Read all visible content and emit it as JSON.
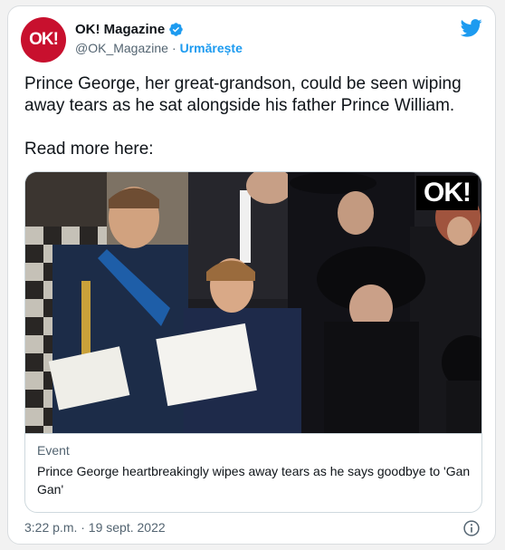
{
  "author": {
    "avatar_text": "OK!",
    "name": "OK! Magazine",
    "handle": "@OK_Magazine",
    "separator": "·",
    "follow_label": "Urmărește"
  },
  "tweet": {
    "line1": "Prince George, her great-grandson, could be seen wiping away tears as he sat alongside his father Prince William.",
    "line2": "Read more here:"
  },
  "link_card": {
    "image_logo": "OK!",
    "domain": "Event",
    "title": "Prince George heartbreakingly wipes away tears as he says goodbye to 'Gan Gan'"
  },
  "footer": {
    "timestamp": "3:22 p.m. · 19 sept. 2022"
  },
  "colors": {
    "accent": "#1d9bf0",
    "brand": "#c8102e"
  },
  "icons": [
    "verified-badge-icon",
    "twitter-bird-icon",
    "info-icon"
  ]
}
